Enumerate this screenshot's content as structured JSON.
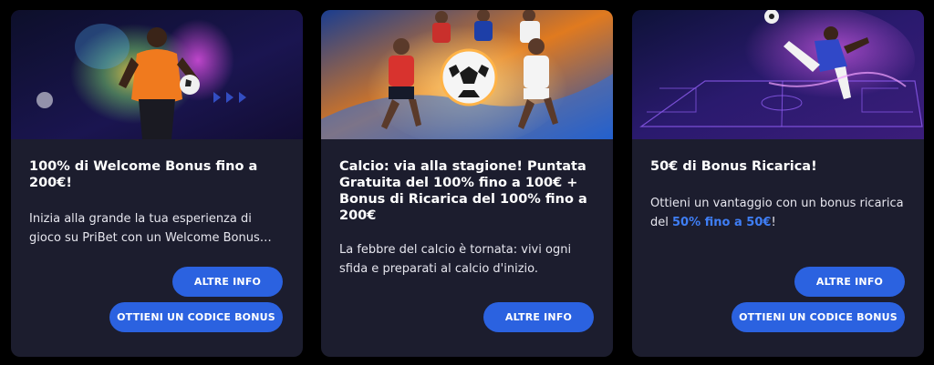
{
  "colors": {
    "page_background": "#000000",
    "card_background": "#1c1d2e",
    "button_background": "#2b62e0",
    "highlight_text": "#3f7ef5"
  },
  "cards": [
    {
      "image": "promo-image-footballer-color-powder",
      "title": "100% di Welcome Bonus fino a 200€!",
      "description": "Inizia alla grande la tua esperienza di gioco su PriBet con un Welcome Bonus…",
      "info_button": "ALTRE INFO",
      "code_button": "OTTIENI UN CODICE BONUS"
    },
    {
      "image": "promo-image-football-players-ball",
      "title": "Calcio: via alla stagione! Puntata Gratuita del 100% fino a 100€ + Bonus di Ricarica del 100% fino a 200€",
      "description": "La febbre del calcio è tornata: vivi ogni sfida e preparati al calcio d'inizio.",
      "info_button": "ALTRE INFO"
    },
    {
      "image": "promo-image-footballer-kick-neon-pitch",
      "title": "50€ di Bonus Ricarica!",
      "description_before": "Ottieni un vantaggio con un bonus ricarica del ",
      "description_highlight": "50% fino a 50€",
      "description_after": "!",
      "info_button": "ALTRE INFO",
      "code_button": "OTTIENI UN CODICE BONUS"
    }
  ]
}
